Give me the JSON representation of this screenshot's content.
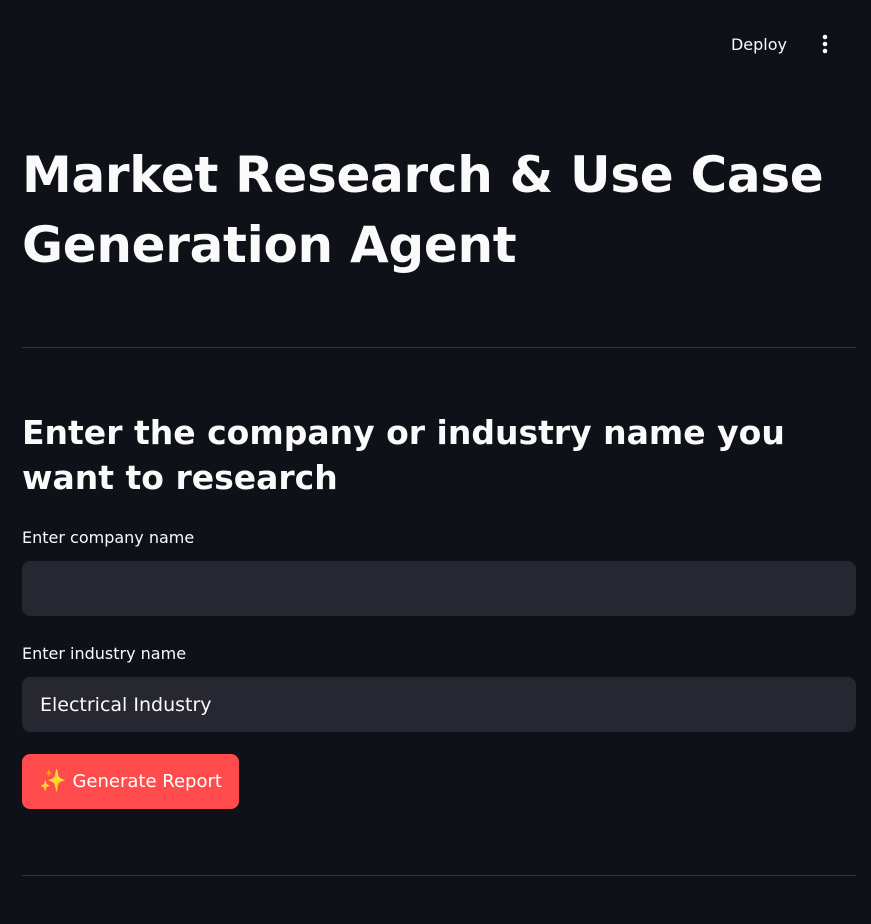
{
  "header": {
    "deploy_label": "Deploy",
    "menu_icon": "vertical-ellipsis-icon"
  },
  "main": {
    "title": "Market Research & Use Case Generation Agent",
    "section_heading": "Enter the company or industry name you want to research",
    "company_field": {
      "label": "Enter company name",
      "value": ""
    },
    "industry_field": {
      "label": "Enter industry name",
      "value": "Electrical Industry"
    },
    "generate_button": {
      "icon": "sparkles-icon",
      "icon_glyph": "✨",
      "label": "Generate Report"
    }
  },
  "colors": {
    "background": "#0e1117",
    "text": "#fafafa",
    "input_background": "#262730",
    "primary_button": "#ff4b4b",
    "divider": "#31333f"
  }
}
